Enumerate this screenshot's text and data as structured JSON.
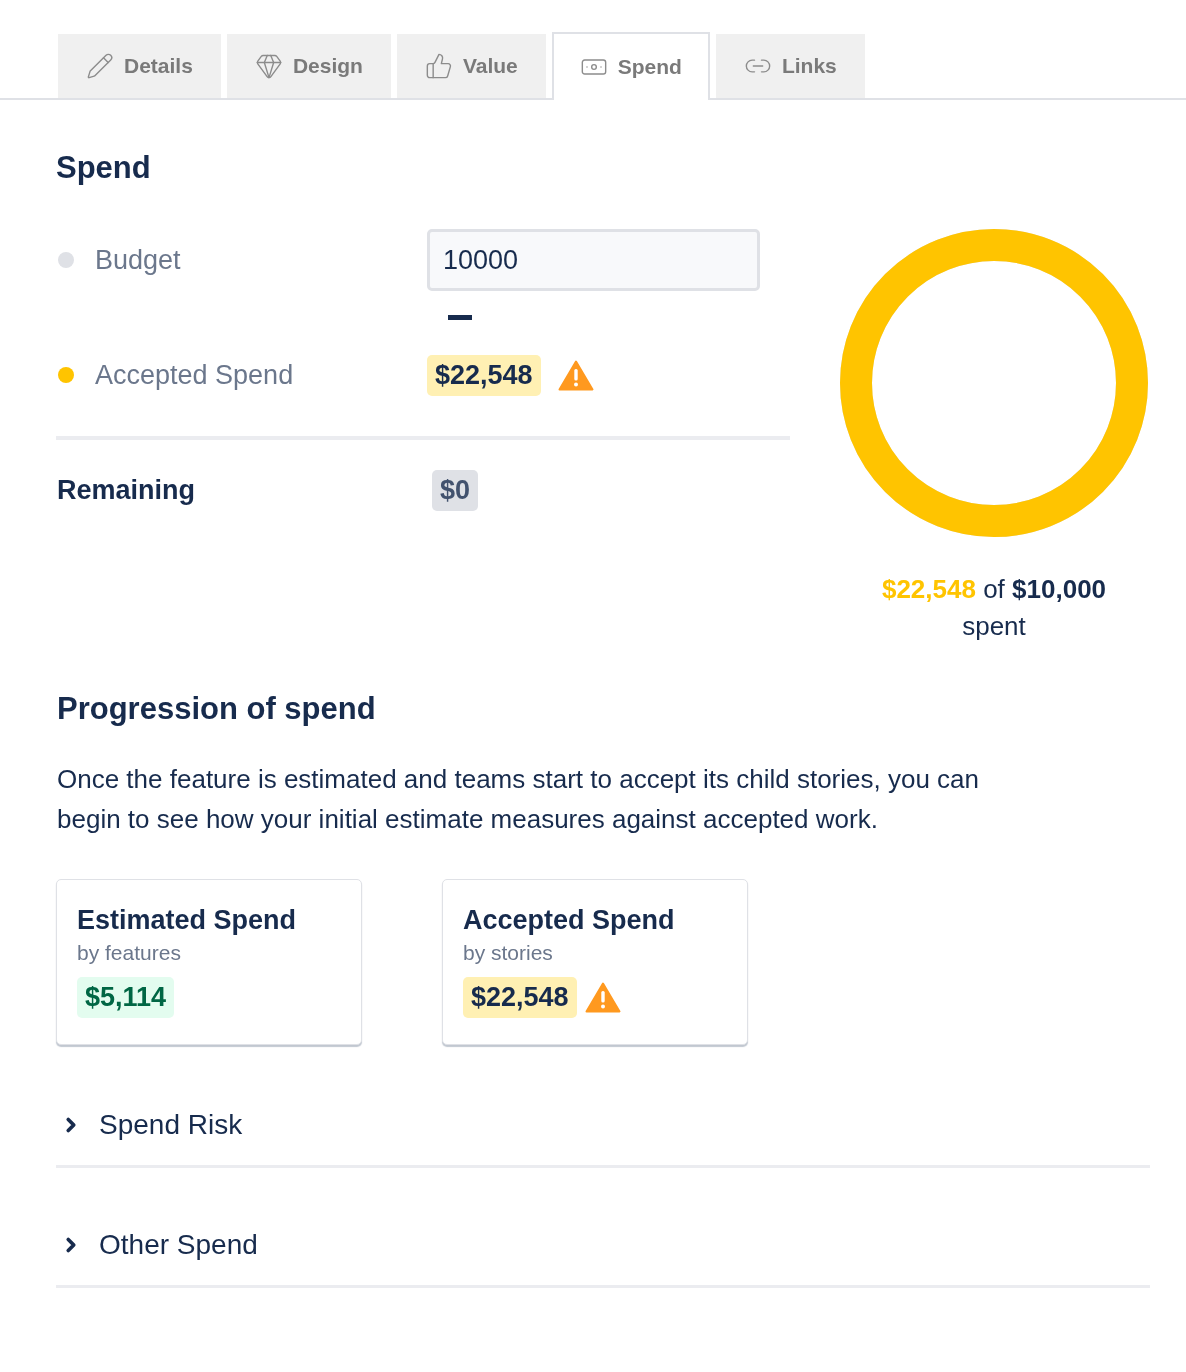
{
  "tabs": [
    {
      "label": "Details",
      "selected": false
    },
    {
      "label": "Design",
      "selected": false
    },
    {
      "label": "Value",
      "selected": false
    },
    {
      "label": "Spend",
      "selected": true
    },
    {
      "label": "Links",
      "selected": false
    }
  ],
  "spend": {
    "title": "Spend",
    "rows": [
      {
        "kind": "input",
        "label": "Budget",
        "color": "#dfe1e6",
        "value": "10000"
      },
      {
        "kind": "amount",
        "label": "Accepted Spend",
        "color": "#ffc400",
        "amount": {
          "kind": "warning",
          "value": "$22,548"
        }
      }
    ],
    "remaining": {
      "label": "Remaining",
      "amount": {
        "kind": "neutral",
        "value": "$0"
      }
    },
    "ring": {
      "level": 1,
      "spent": "$22,548",
      "connector": "of",
      "budget": "$10,000",
      "suffix": "spent"
    }
  },
  "progression": {
    "title": "Progression of spend",
    "description": "Once the feature is estimated and teams start to accept its child stories, you can begin to see how your initial estimate measures against accepted work.",
    "cards": [
      {
        "title": "Estimated Spend",
        "subtitle": "by features",
        "amount": {
          "kind": "success",
          "value": "$5,114"
        }
      },
      {
        "title": "Accepted Spend",
        "subtitle": "by stories",
        "amount": {
          "kind": "warning",
          "value": "$22,548"
        }
      }
    ]
  },
  "sections": [
    {
      "label": "Spend Risk",
      "expanded": false
    },
    {
      "label": "Other Spend",
      "expanded": false
    }
  ]
}
